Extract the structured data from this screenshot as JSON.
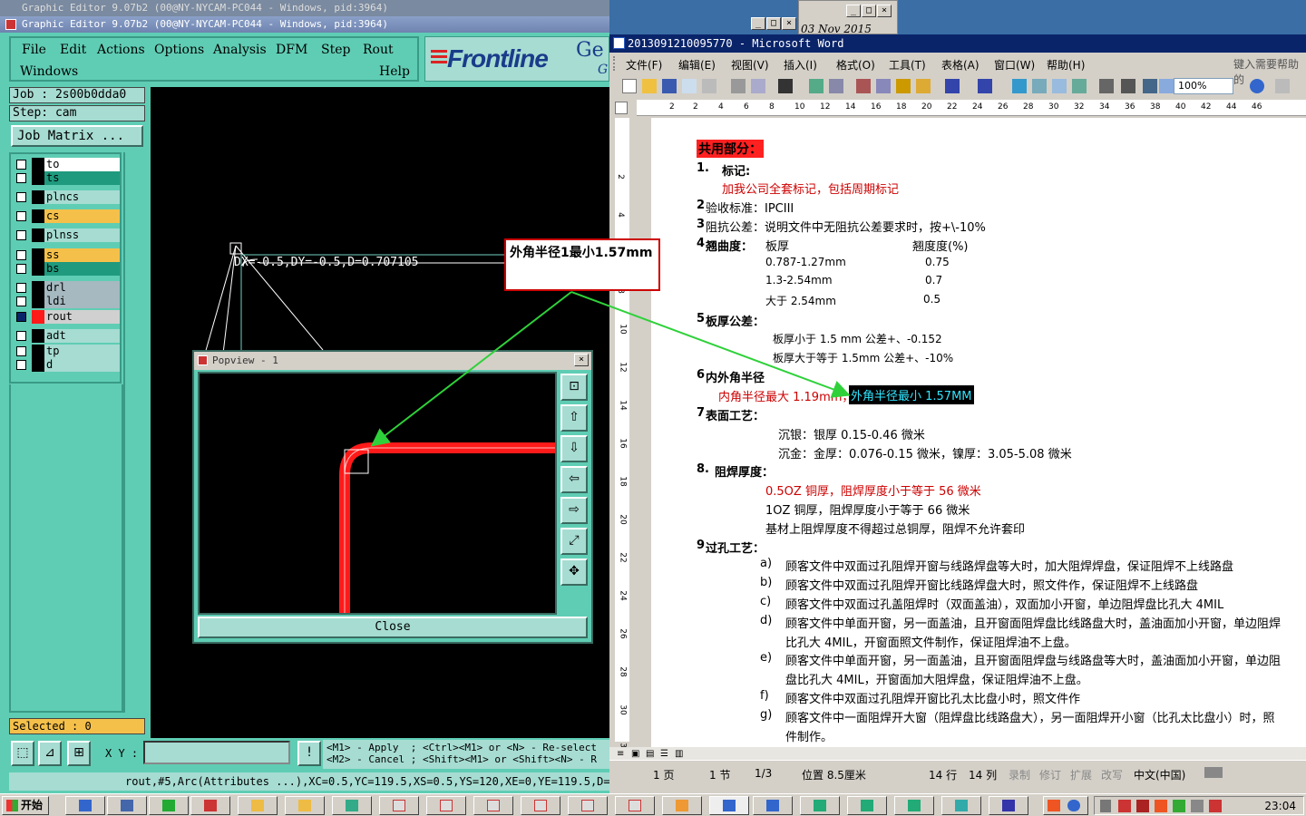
{
  "genesis": {
    "bg_title": "Graphic Editor 9.07b2 (00@NY-NYCAM-PC044 - Windows, pid:3964)",
    "title": "Graphic Editor 9.07b2 (00@NY-NYCAM-PC044 - Windows, pid:3964)",
    "menu": [
      "File",
      "Edit",
      "Actions",
      "Options",
      "Analysis",
      "DFM",
      "Step",
      "Rout"
    ],
    "menu_row2_left": "Windows",
    "menu_row2_right": "Help",
    "logo": "Frontline",
    "logo_partial_1": "Ge",
    "logo_partial_2": "G",
    "job": "Job : 2s00b0dda0",
    "step": "Step: cam",
    "job_matrix": "Job Matrix ...",
    "layers": [
      {
        "name": "to",
        "color": "#ffffff"
      },
      {
        "name": "ts",
        "color": "#1f9a7e"
      },
      {
        "name": "plncs",
        "color": "#a6dcd2"
      },
      {
        "name": "cs",
        "color": "#f5c04a"
      },
      {
        "name": "plnss",
        "color": "#a6dcd2"
      },
      {
        "name": "ss",
        "color": "#f5c04a"
      },
      {
        "name": "bs",
        "color": "#1f9a7e"
      },
      {
        "name": "drl",
        "color": "#a6b8c0"
      },
      {
        "name": "ldi",
        "color": "#a6b8c0"
      },
      {
        "name": "rout",
        "color": "#d0d0d0"
      },
      {
        "name": "adt",
        "color": "#a6dcd2"
      },
      {
        "name": "tp",
        "color": "#a6dcd2"
      },
      {
        "name": "d",
        "color": "#a6dcd2"
      }
    ],
    "measure_text": "DX=-0.5,DY=-0.5,D=0.707105",
    "selected": "Selected : 0",
    "xy_label": "X Y :",
    "warn_label": "!",
    "hint_line1": "<M1> - Apply  ; <Ctrl><M1> or <N> - Re-select",
    "hint_line2": "<M2> - Cancel ; <Shift><M1> or <Shift><N> - R",
    "status": "rout,#5,Arc(Attributes ...),XC=0.5,YC=119.5,XS=0.5,YS=120,XE=0,YE=119.5,D=1,..."
  },
  "popview": {
    "title": "Popview - 1",
    "close": "Close"
  },
  "bg_window": {
    "date": "03 Nov 2015"
  },
  "word": {
    "title": "2013091210095770 - Microsoft Word",
    "menu": [
      "文件(F)",
      "编辑(E)",
      "视图(V)",
      "插入(I)",
      "格式(O)",
      "工具(T)",
      "表格(A)",
      "窗口(W)",
      "帮助(H)"
    ],
    "help_box": "键入需要帮助的",
    "zoom": "100%",
    "ruler_numbers": [
      "2",
      "2",
      "4",
      "6",
      "8",
      "10",
      "12",
      "14",
      "16",
      "18",
      "20",
      "22",
      "24",
      "26",
      "28",
      "30",
      "32",
      "34",
      "36",
      "38",
      "40",
      "42",
      "44",
      "46"
    ],
    "vruler_numbers": [
      "2",
      "4",
      "6",
      "8",
      "10",
      "12",
      "14",
      "16",
      "18",
      "20",
      "22",
      "24",
      "26",
      "28",
      "30",
      "32"
    ],
    "doc": {
      "heading": "共用部分：",
      "s1_num": "1.",
      "s1_title": "标记:",
      "s1_body": "加我公司全套标记，包括周期标记",
      "s2": "验收标准：IPCIII",
      "s2_num": "2",
      "s3_num": "3",
      "s3": "阻抗公差：说明文件中无阻抗公差要求时，按+\\-10%",
      "s4_num": "4",
      "s4_title": "翘曲度：",
      "s4_col1": "板厚",
      "s4_col2": "翘度度(%)",
      "s4_rows": [
        [
          "0.787-1.27mm",
          "0.75"
        ],
        [
          "1.3-2.54mm",
          "0.7"
        ],
        [
          "大于 2.54mm",
          "0.5"
        ]
      ],
      "s5_num": "5",
      "s5_title": "板厚公差：",
      "s5_row1": "板厚小于 1.5  mm     公差+、-0.152",
      "s5_row2": "板厚大于等于 1.5mm   公差+、-10%",
      "s6_num": "6",
      "s6_title": "内外角半径",
      "s6_red": "内角半径最大 1.19mm，",
      "s6_highlight": "外角半径最小 1.57MM",
      "s7_num": "7",
      "s7_title": "表面工艺：",
      "s7_row1": "沉银：银厚 0.15-0.46 微米",
      "s7_row2": "沉金：金厚：0.076-0.15 微米，镍厚：3.05-5.08 微米",
      "s8_num": "8.",
      "s8_title": "阻焊厚度：",
      "s8_row1": "0.5OZ 铜厚，阻焊厚度小于等于 56 微米",
      "s8_row2": "1OZ 铜厚，阻焊厚度小于等于 66 微米",
      "s8_row3": "基材上阻焊厚度不得超过总铜厚，阻焊不允许套印",
      "s9_num": "9",
      "s9_title": "过孔工艺：",
      "s9_items": [
        [
          "a)",
          "顾客文件中双面过孔阻焊开窗与线路焊盘等大时，加大阻焊焊盘，保证阻焊不上线路盘"
        ],
        [
          "b)",
          "顾客文件中双面过孔阻焊开窗比线路焊盘大时，照文件作，保证阻焊不上线路盘"
        ],
        [
          "c)",
          "顾客文件中双面过孔盖阻焊时（双面盖油），双面加小开窗，单边阻焊盘比孔大 4MIL"
        ],
        [
          "d)",
          "顾客文件中单面开窗，另一面盖油，且开窗面阻焊盘比线路盘大时，盖油面加小开窗，单边阻焊"
        ],
        [
          "",
          "比孔大 4MIL，开窗面照文件制作，保证阻焊油不上盘。"
        ],
        [
          "e)",
          "顾客文件中单面开窗，另一面盖油，且开窗面阻焊盘与线路盘等大时，盖油面加小开窗，单边阻"
        ],
        [
          "",
          "盘比孔大 4MIL，开窗面加大阻焊盘，保证阻焊油不上盘。"
        ],
        [
          "f)",
          "顾客文件中双面过孔阻焊开窗比孔太比盘小时，照文件作"
        ],
        [
          "g)",
          "顾客文件中一面阻焊开大窗（阻焊盘比线路盘大），另一面阻焊开小窗（比孔太比盘小）时，照"
        ],
        [
          "",
          "件制作。"
        ]
      ]
    },
    "status": {
      "page": "1 页",
      "section": "1 节",
      "pages": "1/3",
      "pos": "位置 8.5厘米",
      "line": "14 行",
      "col": "14 列",
      "rec": "录制",
      "trk": "修订",
      "ext": "扩展",
      "ovr": "改写",
      "lang": "中文(中国)"
    }
  },
  "callout": "外角半径1最小1.57mm",
  "taskbar": {
    "start": "开始",
    "clock": "23:04"
  },
  "colors": {
    "genesis_bg": "#5fcdb4",
    "genesis_panel": "#a6dcd2",
    "word_title": "#0a246a",
    "rout_red": "#ff1a1a",
    "arrow_green": "#2fd13a",
    "highlight_bg": "#000000",
    "highlight_fg": "#30e6ff"
  }
}
